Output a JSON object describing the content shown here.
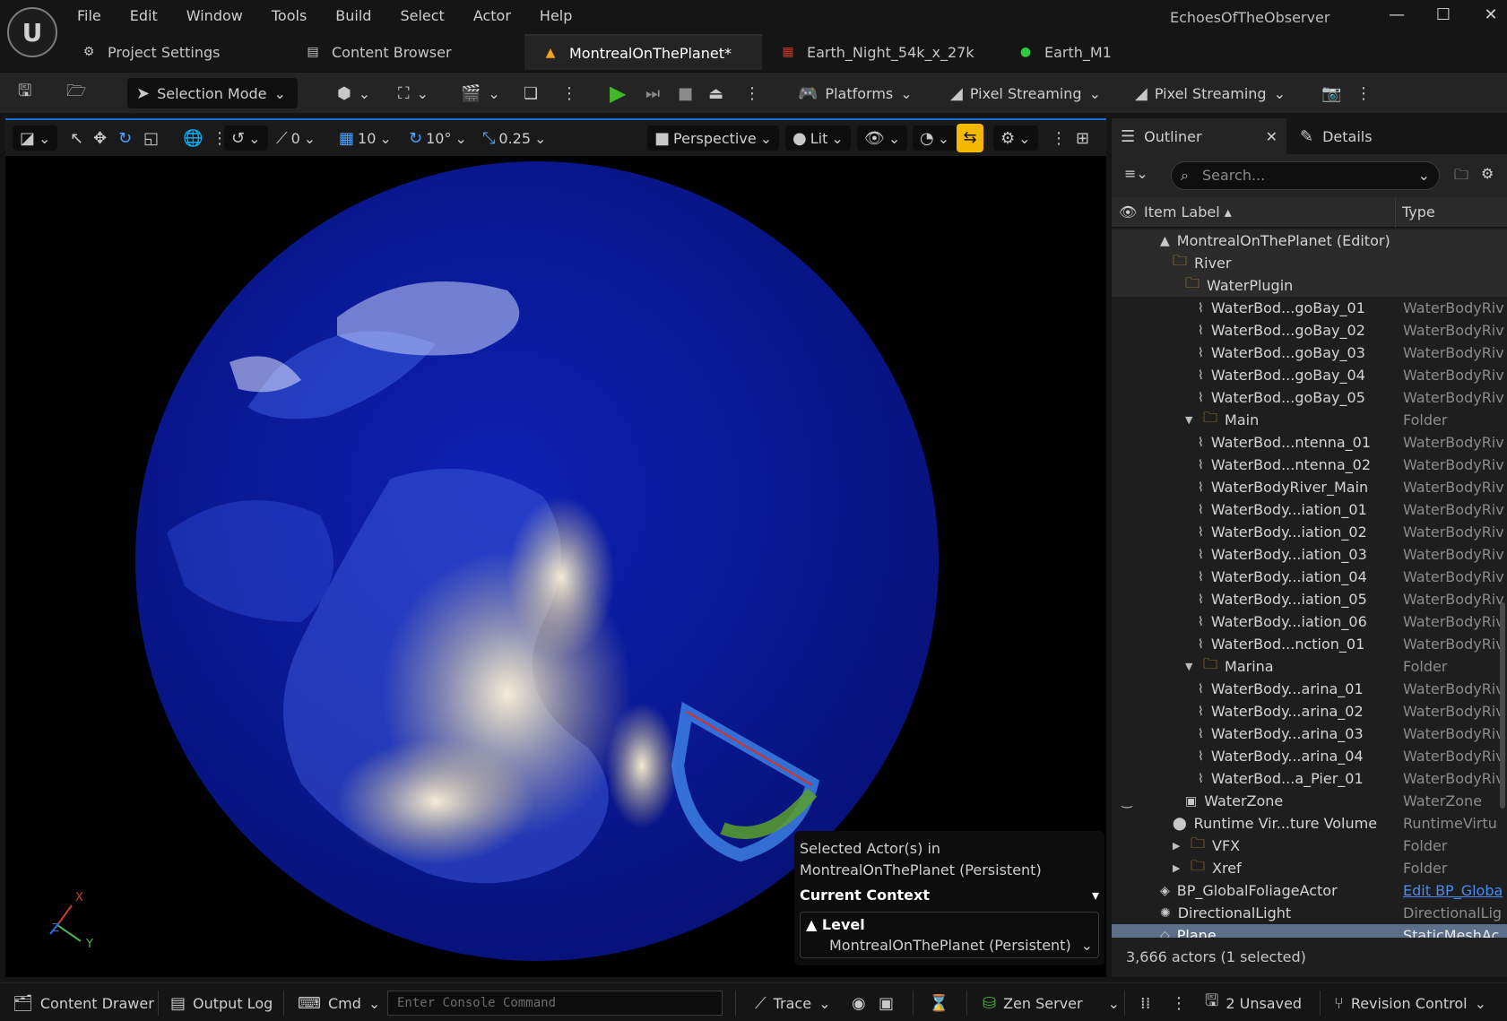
{
  "app": {
    "title": "EchoesOfTheObserver",
    "logo_glyph": "U"
  },
  "menu": [
    "File",
    "Edit",
    "Window",
    "Tools",
    "Build",
    "Select",
    "Actor",
    "Help"
  ],
  "doc_tabs": [
    {
      "label": "Project Settings",
      "icon": "settings-gear-icon"
    },
    {
      "label": "Content Browser",
      "icon": "content-browser-icon"
    },
    {
      "label": "MontrealOnThePlanet*",
      "icon": "level-icon"
    },
    {
      "label": "Earth_Night_54k_x_27k",
      "icon": "texture-icon"
    },
    {
      "label": "Earth_M1",
      "icon": "material-icon"
    }
  ],
  "toolbar": {
    "selection_mode": "Selection Mode",
    "platforms": "Platforms",
    "pixel_streaming_1": "Pixel Streaming",
    "pixel_streaming_2": "Pixel Streaming"
  },
  "viewport": {
    "translate_snap": "0",
    "grid_snap": "10",
    "rotate_snap": "10°",
    "scale_snap": "0.25",
    "view_mode": "Perspective",
    "lighting": "Lit",
    "axis_x": "X",
    "axis_y": "Y",
    "axis_z": "Z",
    "context": {
      "selected_line1": "Selected Actor(s) in",
      "selected_line2": "MontrealOnThePlanet (Persistent)",
      "current_context": "Current Context",
      "level_label": "Level",
      "level_value": "MontrealOnThePlanet (Persistent)"
    }
  },
  "outliner": {
    "tab_outliner": "Outliner",
    "tab_details": "Details",
    "search_placeholder": "Search...",
    "col_item_label": "Item Label",
    "col_type": "Type",
    "rows": [
      {
        "label": "MontrealOnThePlanet (Editor)",
        "type": "",
        "indent": 0,
        "icon": "level-icon"
      },
      {
        "label": "River",
        "type": "",
        "indent": 1,
        "icon": "folder-icon"
      },
      {
        "label": "WaterPlugin",
        "type": "",
        "indent": 2,
        "icon": "folder-icon"
      },
      {
        "label": "WaterBod...goBay_01",
        "type": "WaterBodyRiv",
        "indent": 3,
        "icon": "water-body-icon"
      },
      {
        "label": "WaterBod...goBay_02",
        "type": "WaterBodyRiv",
        "indent": 3,
        "icon": "water-body-icon"
      },
      {
        "label": "WaterBod...goBay_03",
        "type": "WaterBodyRiv",
        "indent": 3,
        "icon": "water-body-icon"
      },
      {
        "label": "WaterBod...goBay_04",
        "type": "WaterBodyRiv",
        "indent": 3,
        "icon": "water-body-icon"
      },
      {
        "label": "WaterBod...goBay_05",
        "type": "WaterBodyRiv",
        "indent": 3,
        "icon": "water-body-icon"
      },
      {
        "label": "Main",
        "type": "Folder",
        "indent": 2,
        "icon": "folder-icon",
        "expanded": true
      },
      {
        "label": "WaterBod...ntenna_01",
        "type": "WaterBodyRiv",
        "indent": 3,
        "icon": "water-body-icon"
      },
      {
        "label": "WaterBod...ntenna_02",
        "type": "WaterBodyRiv",
        "indent": 3,
        "icon": "water-body-icon"
      },
      {
        "label": "WaterBodyRiver_Main",
        "type": "WaterBodyRiv",
        "indent": 3,
        "icon": "water-body-icon"
      },
      {
        "label": "WaterBody...iation_01",
        "type": "WaterBodyRiv",
        "indent": 3,
        "icon": "water-body-icon"
      },
      {
        "label": "WaterBody...iation_02",
        "type": "WaterBodyRiv",
        "indent": 3,
        "icon": "water-body-icon"
      },
      {
        "label": "WaterBody...iation_03",
        "type": "WaterBodyRiv",
        "indent": 3,
        "icon": "water-body-icon"
      },
      {
        "label": "WaterBody...iation_04",
        "type": "WaterBodyRiv",
        "indent": 3,
        "icon": "water-body-icon"
      },
      {
        "label": "WaterBody...iation_05",
        "type": "WaterBodyRiv",
        "indent": 3,
        "icon": "water-body-icon"
      },
      {
        "label": "WaterBody...iation_06",
        "type": "WaterBodyRiv",
        "indent": 3,
        "icon": "water-body-icon"
      },
      {
        "label": "WaterBod...nction_01",
        "type": "WaterBodyRiv",
        "indent": 3,
        "icon": "water-body-icon"
      },
      {
        "label": "Marina",
        "type": "Folder",
        "indent": 2,
        "icon": "folder-icon",
        "expanded": true
      },
      {
        "label": "WaterBody...arina_01",
        "type": "WaterBodyRiv",
        "indent": 3,
        "icon": "water-body-icon"
      },
      {
        "label": "WaterBody...arina_02",
        "type": "WaterBodyRiv",
        "indent": 3,
        "icon": "water-body-icon"
      },
      {
        "label": "WaterBody...arina_03",
        "type": "WaterBodyRiv",
        "indent": 3,
        "icon": "water-body-icon"
      },
      {
        "label": "WaterBody...arina_04",
        "type": "WaterBodyRiv",
        "indent": 3,
        "icon": "water-body-icon"
      },
      {
        "label": "WaterBod...a_Pier_01",
        "type": "WaterBodyRiv",
        "indent": 3,
        "icon": "water-body-icon"
      },
      {
        "label": "WaterZone",
        "type": "WaterZone",
        "indent": 2,
        "icon": "water-zone-icon",
        "eye": true
      },
      {
        "label": "Runtime Vir...ture Volume",
        "type": "RuntimeVirtu",
        "indent": 1,
        "icon": "volume-icon"
      },
      {
        "label": "VFX",
        "type": "Folder",
        "indent": 1,
        "icon": "folder-icon",
        "collapsed": true
      },
      {
        "label": "Xref",
        "type": "Folder",
        "indent": 1,
        "icon": "folder-icon",
        "collapsed": true
      },
      {
        "label": "BP_GlobalFoliageActor",
        "type": "Edit BP_Globa",
        "indent": 0,
        "icon": "blueprint-icon",
        "link": true
      },
      {
        "label": "DirectionalLight",
        "type": "DirectionalLig",
        "indent": 0,
        "icon": "light-icon"
      },
      {
        "label": "Plane",
        "type": "StaticMeshAc",
        "indent": 0,
        "icon": "mesh-icon",
        "selected": true,
        "eye": true
      }
    ],
    "footer": "3,666 actors (1 selected)"
  },
  "statusbar": {
    "content_drawer": "Content Drawer",
    "output_log": "Output Log",
    "cmd": "Cmd",
    "console_placeholder": "Enter Console Command",
    "trace": "Trace",
    "zen_server": "Zen Server",
    "unsaved": "2 Unsaved",
    "revision_control": "Revision Control"
  },
  "colors": {
    "accent_selection": "#f5b800",
    "play_green": "#42b72a",
    "selected_row": "#5c6f88",
    "link_blue": "#4a8cf0",
    "ocean": "#0b1a9c"
  }
}
